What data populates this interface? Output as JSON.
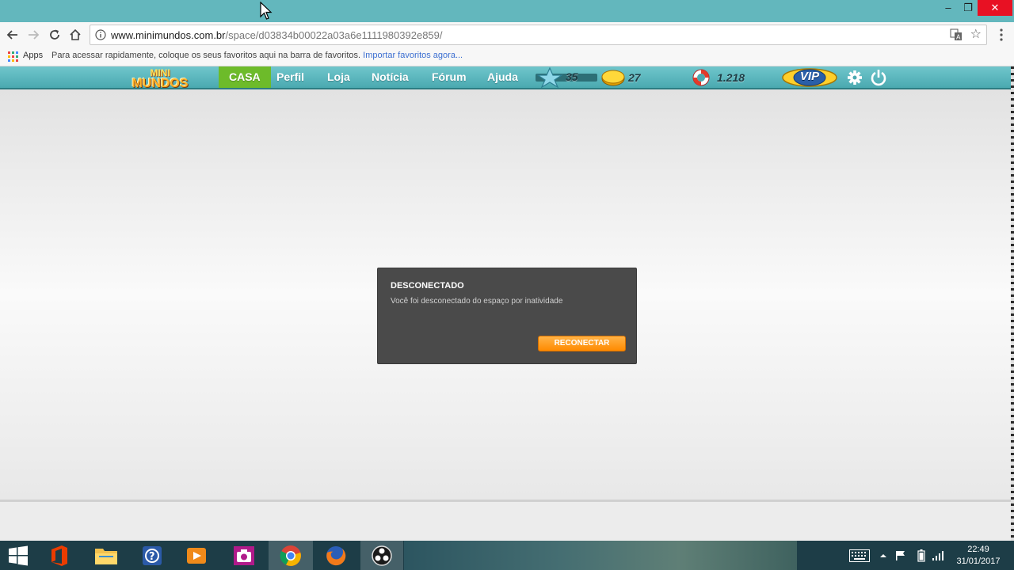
{
  "window": {
    "minimize_glyph": "‒",
    "restore_glyph": "❐",
    "close_glyph": "✕"
  },
  "toolbar": {
    "url_host": "www.minimundos.com.br",
    "url_path": "/space/d03834b00022a03a6e1111980392e859/"
  },
  "bookmarks": {
    "apps_label": "Apps",
    "hint": "Para acessar rapidamente, coloque os seus favoritos aqui na barra de favoritos.",
    "import_link": "Importar favoritos agora..."
  },
  "game": {
    "logo_line1": "MINI",
    "logo_line2": "MUNDOS",
    "nav": {
      "casa": "CASA",
      "perfil": "Perfil",
      "loja": "Loja",
      "noticia": "Notícia",
      "forum": "Fórum",
      "ajuda": "Ajuda"
    },
    "stats": {
      "level": "35",
      "coins": "27",
      "credits": "1.218",
      "vip_label": "VIP"
    }
  },
  "dialog": {
    "title": "DESCONECTADO",
    "message": "Você foi desconectado do espaço por inatividade",
    "button": "RECONECTAR"
  },
  "taskbar": {
    "time": "22:49",
    "date": "31/01/2017"
  },
  "colors": {
    "titlebar": "#63b7bd",
    "game_header": "#4aa9b0",
    "nav_active": "#6dbb2a",
    "dialog_bg": "#4a4a4a",
    "button_orange": "#ff8a00",
    "taskbar": "#1d3d47"
  }
}
